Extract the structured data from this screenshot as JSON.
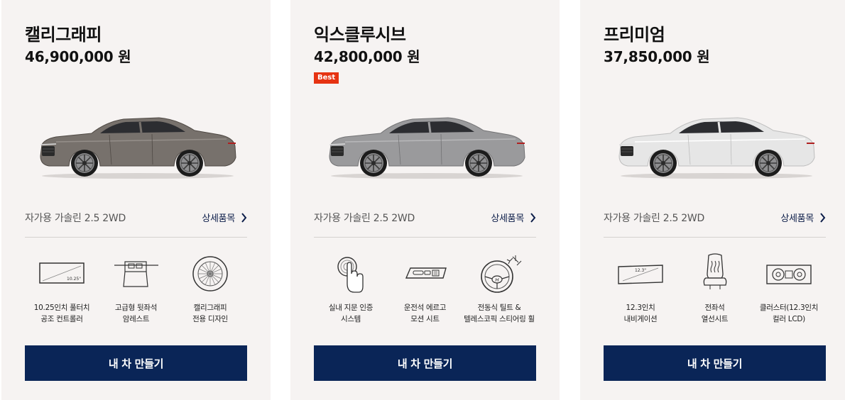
{
  "trims": [
    {
      "name": "캘리그래피",
      "price": "46,900,000 원",
      "badge": "",
      "car_color": "#77716c",
      "engine": "자가용 가솔린 2.5 2WD",
      "detail_label": "상세품목",
      "features": [
        {
          "label": "10.25인치 풀터치\n공조 컨트롤러",
          "icon": "touchscreen-icon",
          "icon_text": "10.25\""
        },
        {
          "label": "고급형 뒷좌석\n암레스트",
          "icon": "armrest-icon",
          "icon_text": ""
        },
        {
          "label": "캘리그래피\n전용 디자인",
          "icon": "wheel-icon",
          "icon_text": ""
        }
      ],
      "button_label": "내 차 만들기"
    },
    {
      "name": "익스클루시브",
      "price": "42,800,000 원",
      "badge": "Best",
      "car_color": "#9a9a9c",
      "engine": "자가용 가솔린 2.5 2WD",
      "detail_label": "상세품목",
      "features": [
        {
          "label": "실내 지문 인증\n시스템",
          "icon": "fingerprint-icon",
          "icon_text": ""
        },
        {
          "label": "운전석 에르고\n모션 시트",
          "icon": "seat-control-icon",
          "icon_text": ""
        },
        {
          "label": "전동식 틸트 &\n텔레스코픽 스티어링 휠",
          "icon": "steering-wheel-icon",
          "icon_text": ""
        }
      ],
      "button_label": "내 차 만들기"
    },
    {
      "name": "프리미엄",
      "price": "37,850,000 원",
      "badge": "",
      "car_color": "#e6e6e6",
      "engine": "자가용 가솔린 2.5 2WD",
      "detail_label": "상세품목",
      "features": [
        {
          "label": "12.3인치\n내비게이션",
          "icon": "navigation-screen-icon",
          "icon_text": "12.3\""
        },
        {
          "label": "전좌석\n열선시트",
          "icon": "heated-seat-icon",
          "icon_text": ""
        },
        {
          "label": "클러스터(12.3인치\n컬러 LCD)",
          "icon": "cluster-icon",
          "icon_text": ""
        }
      ],
      "button_label": "내 차 만들기"
    }
  ]
}
